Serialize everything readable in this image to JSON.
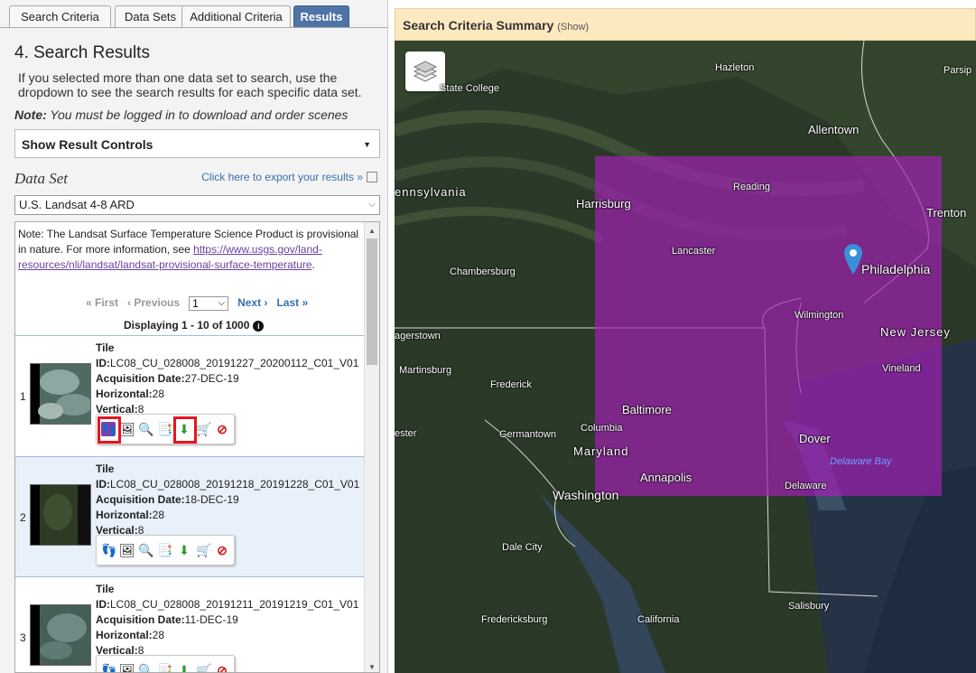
{
  "tabs": [
    "Search Criteria",
    "Data Sets",
    "Additional Criteria",
    "Results"
  ],
  "heading": "4. Search Results",
  "intro": "If you selected more than one data set to search, use the dropdown to see the search results for each specific data set.",
  "note_label": "Note:",
  "note_text": " You must be logged in to download and order scenes",
  "controls_label": "Show Result Controls",
  "dataset_label": "Data Set",
  "export_link": "Click here to export your results »",
  "dataset_value": "U.S. Landsat 4-8 ARD",
  "result_note": {
    "text": "Note: The Landsat Surface Temperature Science Product is provisional in nature. For more information, see ",
    "link": "https://www.usgs.gov/land-resources/nli/landsat/landsat-provisional-surface-temperature",
    "end": "."
  },
  "pager": {
    "first": "« First",
    "previous": "‹ Previous",
    "page": "1",
    "next": "Next ›",
    "last": "Last »"
  },
  "displaying": "Displaying 1 - 10 of 1000",
  "field_labels": {
    "tile": "Tile",
    "id": "ID:",
    "acq": "Acquisition Date:",
    "horiz": "Horizontal:",
    "vert": "Vertical:"
  },
  "results": [
    {
      "num": "1",
      "id": "LC08_CU_028008_20191227_20200112_C01_V01",
      "date": "27-DEC-19",
      "h": "28",
      "v": "8"
    },
    {
      "num": "2",
      "id": "LC08_CU_028008_20191218_20191228_C01_V01",
      "date": "18-DEC-19",
      "h": "28",
      "v": "8"
    },
    {
      "num": "3",
      "id": "LC08_CU_028008_20191211_20191219_C01_V01",
      "date": "11-DEC-19",
      "h": "28",
      "v": "8"
    }
  ],
  "summary": {
    "title": "Search Criteria Summary",
    "toggle": "(Show)"
  },
  "map_labels": {
    "hazleton": "Hazleton",
    "state_college": "State College",
    "parsippany": "Parsip",
    "allentown": "Allentown",
    "pennsylvania": "ennsylvania",
    "reading": "Reading",
    "harrisburg": "Harrisburg",
    "trenton": "Trenton",
    "lancaster": "Lancaster",
    "chambersburg": "Chambersburg",
    "philadelphia": "Philadelphia",
    "wilmington": "Wilmington",
    "new_jersey": "New Jersey",
    "hagerstown": "agerstown",
    "martinsburg": "Martinsburg",
    "vineland": "Vineland",
    "frederick": "Frederick",
    "baltimore": "Baltimore",
    "columbia": "Columbia",
    "winchester": "ester",
    "germantown": "Germantown",
    "maryland": "Maryland",
    "dover": "Dover",
    "delaware_bay": "Delaware Bay",
    "annapolis": "Annapolis",
    "washington": "Washington",
    "delaware": "Delaware",
    "dale_city": "Dale City",
    "salisbury": "Salisbury",
    "fredericksburg": "Fredericksburg",
    "california": "California"
  }
}
